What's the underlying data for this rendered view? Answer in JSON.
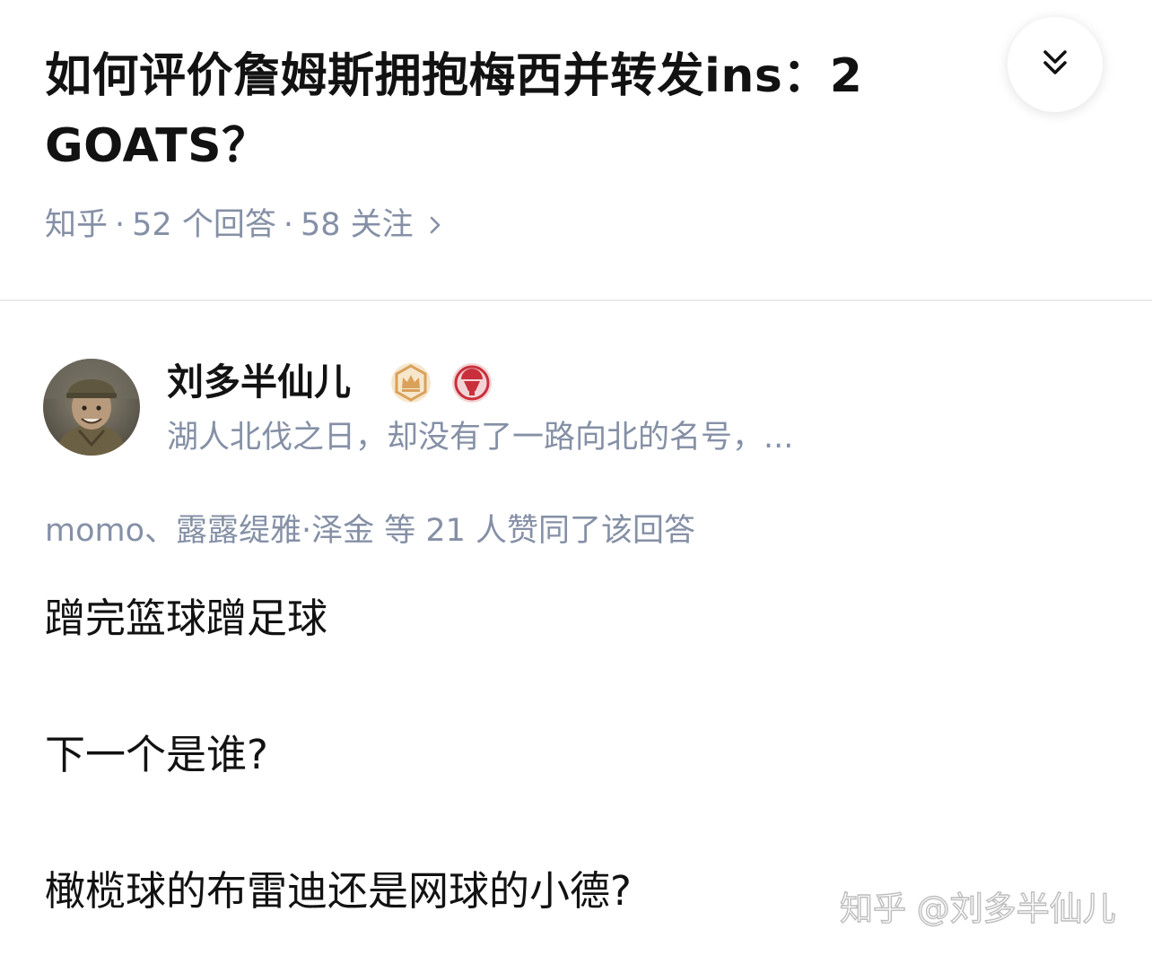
{
  "question": {
    "title": "如何评价詹姆斯拥抱梅西并转发ins：2 GOATS？",
    "source": "知乎",
    "answers_count": "52 个回答",
    "followers_count": "58 关注",
    "collapse_icon": "double-chevron-down-icon"
  },
  "author": {
    "name": "刘多半仙儿",
    "bio": "湖人北伐之日，却没有了一路向北的名号，...",
    "badges": [
      "crown-badge-icon",
      "mic-badge-icon"
    ]
  },
  "voters": "momo、露露缇雅·泽金 等 21 人赞同了该回答",
  "answer": {
    "paragraphs": [
      "蹭完篮球蹭足球",
      "下一个是谁?",
      "橄榄球的布雷迪还是网球的小德?"
    ]
  },
  "watermark": "知乎 @刘多半仙儿",
  "colors": {
    "meta_gray": "#8590a6",
    "text_dark": "#121212",
    "crown_gold": "#d9a15a",
    "mic_red": "#c9303b"
  }
}
